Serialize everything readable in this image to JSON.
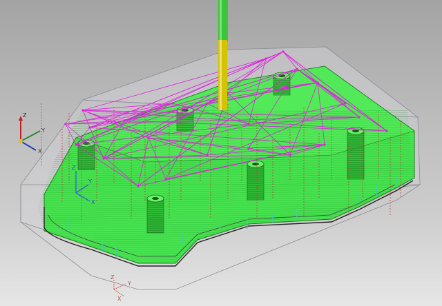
{
  "viewport": {
    "background_top": "#a3a3a3",
    "background_bottom": "#e6e6e6"
  },
  "colors": {
    "part_fill": "#2fe63a",
    "part_edge": "#1a7a1a",
    "stock_fill": "#d6d6de",
    "stock_edge": "#8a8a96",
    "rapid_moves": "#e020e0",
    "feed_moves": "#d03030",
    "tool_holder": "#3ec43a",
    "tool_cutter": "#d4c400",
    "plunge_marks": "#40c8c8"
  },
  "triad_main": {
    "z": "Z",
    "y": "Y",
    "x": "X"
  },
  "triad_wcs": {
    "z": "Z",
    "y": "Y",
    "x": "X"
  },
  "triad_origin": {
    "z": "Z",
    "y": "Y",
    "x": "X"
  }
}
